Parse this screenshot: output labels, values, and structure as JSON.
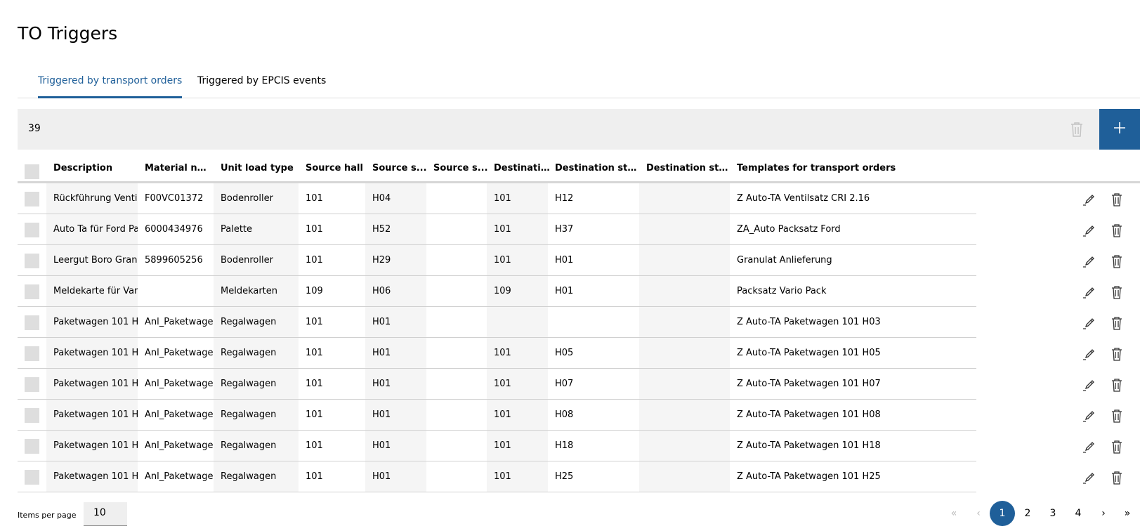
{
  "page": {
    "title": "TO Triggers"
  },
  "tabs": [
    {
      "label": "Triggered by transport orders",
      "active": true
    },
    {
      "label": "Triggered by EPCIS events",
      "active": false
    }
  ],
  "toolbar": {
    "count": "39",
    "delete_icon": "trash-icon",
    "add_icon": "plus-icon"
  },
  "table": {
    "columns": [
      "Description",
      "Material nu...",
      "Unit load type",
      "Source hall",
      "Source s...",
      "Source s...",
      "Destinati...",
      "Destination stat...",
      "Destination stor...",
      "Templates for transport orders"
    ],
    "rows": [
      [
        "Rückführung Ventil",
        "F00VC01372",
        "Bodenroller",
        "101",
        "H04",
        "",
        "101",
        "H12",
        "",
        "Z Auto-TA Ventilsatz CRI 2.16"
      ],
      [
        "Auto Ta für Ford Pa",
        "6000434976",
        "Palette",
        "101",
        "H52",
        "",
        "101",
        "H37",
        "",
        "ZA_Auto Packsatz Ford"
      ],
      [
        "Leergut Boro Gran",
        "5899605256",
        "Bodenroller",
        "101",
        "H29",
        "",
        "101",
        "H01",
        "",
        "Granulat Anlieferung"
      ],
      [
        "Meldekarte für Var",
        "",
        "Meldekarten",
        "109",
        "H06",
        "",
        "109",
        "H01",
        "",
        "Packsatz Vario Pack"
      ],
      [
        "Paketwagen 101 H",
        "Anl_Paketwage",
        "Regalwagen",
        "101",
        "H01",
        "",
        "",
        "",
        "",
        "Z Auto-TA Paketwagen 101 H03"
      ],
      [
        "Paketwagen 101 H",
        "Anl_Paketwage",
        "Regalwagen",
        "101",
        "H01",
        "",
        "101",
        "H05",
        "",
        "Z Auto-TA Paketwagen 101 H05"
      ],
      [
        "Paketwagen 101 H",
        "Anl_Paketwage",
        "Regalwagen",
        "101",
        "H01",
        "",
        "101",
        "H07",
        "",
        "Z Auto-TA Paketwagen 101 H07"
      ],
      [
        "Paketwagen 101 H",
        "Anl_Paketwage",
        "Regalwagen",
        "101",
        "H01",
        "",
        "101",
        "H08",
        "",
        "Z Auto-TA Paketwagen 101 H08"
      ],
      [
        "Paketwagen 101 H",
        "Anl_Paketwage",
        "Regalwagen",
        "101",
        "H01",
        "",
        "101",
        "H18",
        "",
        "Z Auto-TA Paketwagen 101 H18"
      ],
      [
        "Paketwagen 101 H",
        "Anl_Paketwage",
        "Regalwagen",
        "101",
        "H01",
        "",
        "101",
        "H25",
        "",
        "Z Auto-TA Paketwagen 101 H25"
      ]
    ],
    "row_icons": {
      "edit": "pencil-icon",
      "delete": "trash-icon"
    }
  },
  "footer": {
    "items_per_page_label": "Items per page",
    "items_per_page_value": "10",
    "pages": [
      "1",
      "2",
      "3",
      "4"
    ],
    "current_page": "1",
    "first_icon": "«",
    "prev_icon": "‹",
    "next_icon": "›",
    "last_icon": "»"
  },
  "colors": {
    "accent": "#1f5f99",
    "toolbar_bg": "#efefef",
    "shaded_cell": "#f5f5f5"
  }
}
